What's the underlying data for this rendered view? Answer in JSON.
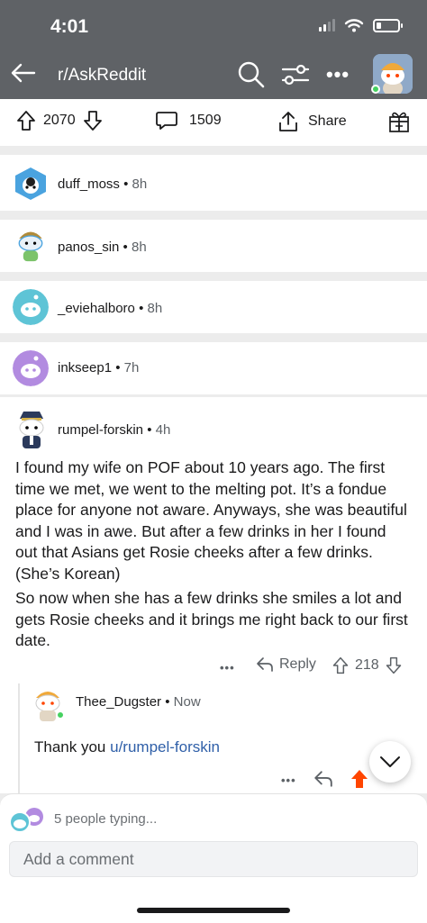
{
  "status_bar": {
    "time": "4:01"
  },
  "nav": {
    "subreddit": "r/AskReddit",
    "icons": [
      "back-arrow-icon",
      "search-icon",
      "filter-icon",
      "more-icon",
      "user-avatar"
    ]
  },
  "post_actions": {
    "upvotes": "2070",
    "comments": "1509",
    "share_label": "Share"
  },
  "collapsed_comments": [
    {
      "username": "duff_moss",
      "time": "8h"
    },
    {
      "username": "panos_sin",
      "time": "8h"
    },
    {
      "username": "_eviehalboro",
      "time": "8h"
    },
    {
      "username": "inkseep1",
      "time": "7h"
    }
  ],
  "comment": {
    "username": "rumpel-forskin",
    "time": "4h",
    "paragraphs": [
      "I found my wife on POF about 10 years ago.  The first time we met, we went to the melting pot.  It’s a fondue place for anyone not aware.  Anyways, she was beautiful and I was in awe. But after a few drinks in her I found out that Asians get Rosie cheeks after a few drinks.  (She’s Korean)",
      "So now when she has a few drinks she smiles a lot and gets Rosie cheeks and it brings me right back to our first date."
    ],
    "more": "•••",
    "reply_label": "Reply",
    "votes": "218"
  },
  "reply": {
    "username": "Thee_Dugster",
    "time": "Now",
    "text": "Thank you ",
    "mention": "u/rumpel-forskin",
    "more": "•••"
  },
  "composer": {
    "typing": "5 people typing...",
    "placeholder": "Add a comment"
  },
  "colors": {
    "header_bg": "#5f6266",
    "upvote_orange": "#ff4500",
    "link_blue": "#2f5fa8",
    "online_green": "#46d160"
  }
}
